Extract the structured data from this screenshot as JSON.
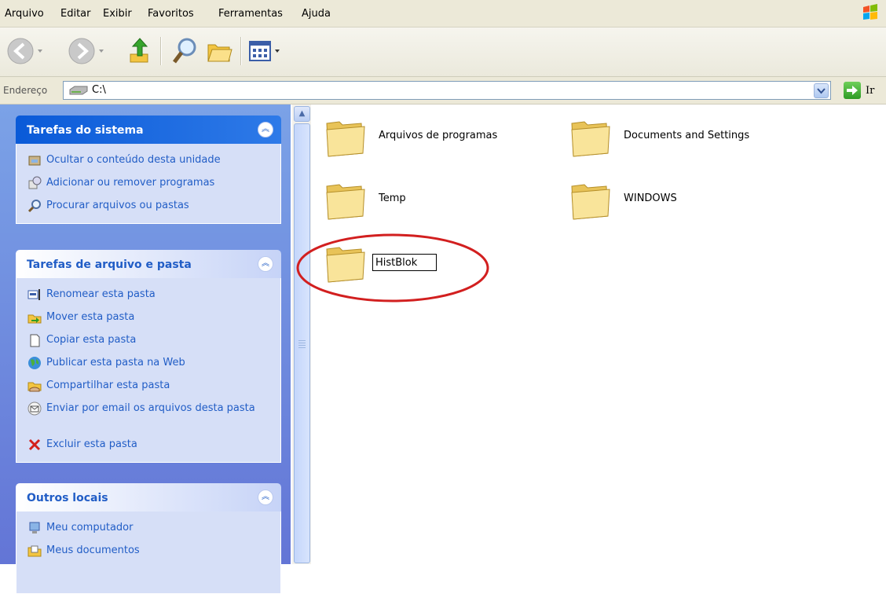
{
  "menu": [
    "Arquivo",
    "Editar",
    "Exibir",
    "Favoritos",
    "Ferramentas",
    "Ajuda"
  ],
  "address": {
    "label": "Endereço",
    "value": "C:\\",
    "go_label": "Ir"
  },
  "panels": {
    "system": {
      "title": "Tarefas do sistema",
      "items": [
        "Ocultar o conteúdo desta unidade",
        "Adicionar ou remover programas",
        "Procurar arquivos ou pastas"
      ]
    },
    "file": {
      "title": "Tarefas de arquivo e pasta",
      "items": [
        "Renomear esta pasta",
        "Mover esta pasta",
        "Copiar esta pasta",
        "Publicar esta pasta na Web",
        "Compartilhar esta pasta",
        "Enviar por email os arquivos desta pasta",
        "Excluir esta pasta"
      ]
    },
    "other": {
      "title": "Outros locais",
      "items": [
        "Meu computador",
        "Meus documentos"
      ]
    }
  },
  "folders": [
    "Arquivos de programas",
    "Documents and Settings",
    "Temp",
    "WINDOWS"
  ],
  "rename_value": "HistBlok",
  "colors": {
    "task_pane": "#6e8fe0",
    "link": "#215dc6",
    "highlight_circle": "#d21f1f",
    "folder": "#f7e08a"
  }
}
